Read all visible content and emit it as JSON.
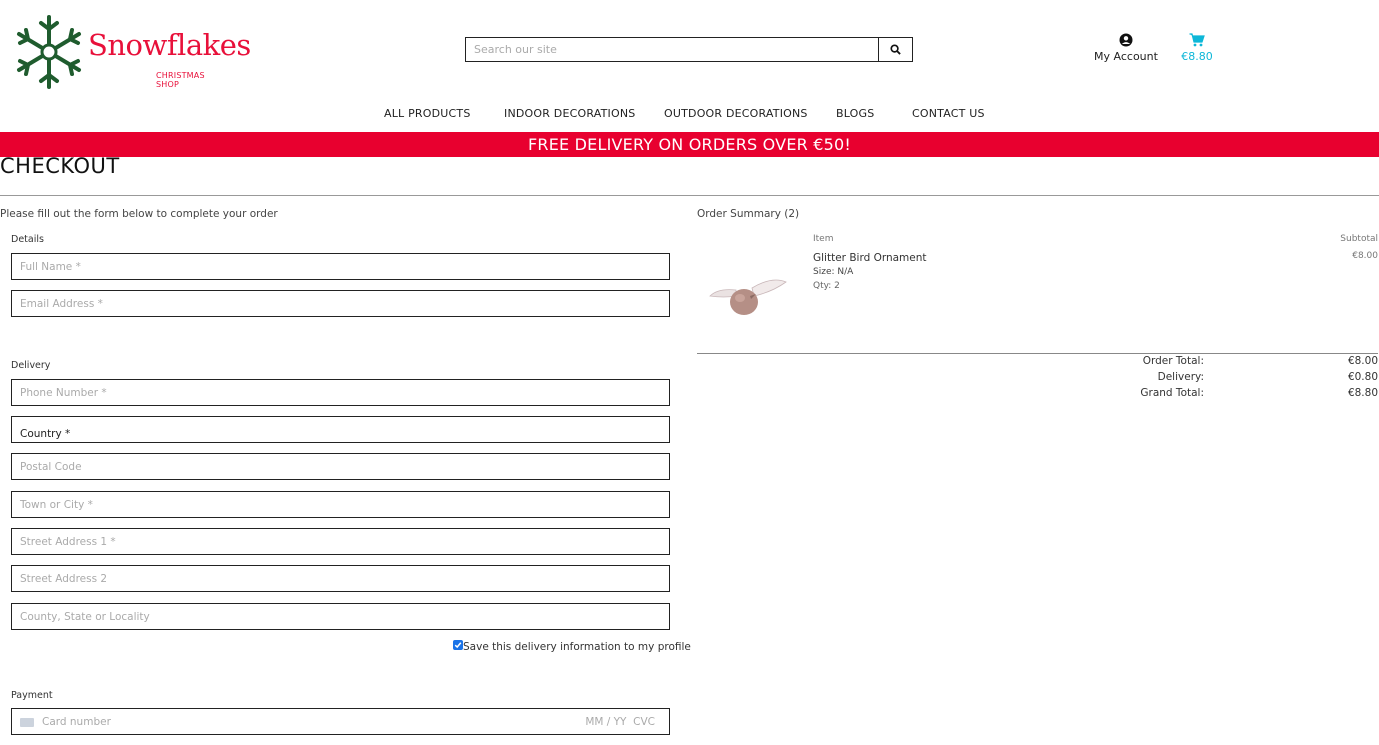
{
  "brand": {
    "name": "Snowflakes",
    "tagline": "CHRISTMAS SHOP",
    "color": "#e8103a",
    "logo_icon": "snowflake-icon",
    "logo_icon_color": "#1f5c2e"
  },
  "search": {
    "placeholder": "Search our site",
    "icon": "search-icon"
  },
  "account": {
    "label": "My Account",
    "icon": "user-circle-icon"
  },
  "cart": {
    "amount": "€8.80",
    "icon": "cart-icon",
    "color": "#0db7d8"
  },
  "nav": {
    "items": [
      {
        "label": "ALL PRODUCTS"
      },
      {
        "label": "INDOOR DECORATIONS"
      },
      {
        "label": "OUTDOOR DECORATIONS"
      },
      {
        "label": "BLOGS"
      },
      {
        "label": "CONTACT US"
      }
    ]
  },
  "banner": {
    "text": "FREE DELIVERY ON ORDERS OVER €50!",
    "color": "#e8002f"
  },
  "page": {
    "title": "CHECKOUT",
    "intro": "Please fill out the form below to complete your order"
  },
  "form": {
    "details_label": "Details",
    "full_name_placeholder": "Full Name *",
    "email_placeholder": "Email Address *",
    "delivery_label": "Delivery",
    "phone_placeholder": "Phone Number *",
    "country_value": "Country *",
    "postal_placeholder": "Postal Code",
    "town_placeholder": "Town or City *",
    "street1_placeholder": "Street Address 1 *",
    "street2_placeholder": "Street Address 2",
    "county_placeholder": "County, State or Locality",
    "save_label": "Save this delivery information to my profile",
    "save_checked": true,
    "payment_label": "Payment",
    "card_placeholder": "Card number",
    "card_extra": "MM / YY  CVC",
    "card_icon": "credit-card-icon"
  },
  "summary": {
    "title": "Order Summary (2)",
    "col_item": "Item",
    "col_subtotal": "Subtotal",
    "items": [
      {
        "name": "Glitter Bird Ornament",
        "size": "Size: N/A",
        "qty": "Qty: 2",
        "subtotal": "€8.00",
        "image_icon": "bird-ornament-image"
      }
    ],
    "order_total_label": "Order Total:",
    "order_total": "€8.00",
    "delivery_label": "Delivery:",
    "delivery": "€0.80",
    "grand_total_label": "Grand Total:",
    "grand_total": "€8.80"
  }
}
